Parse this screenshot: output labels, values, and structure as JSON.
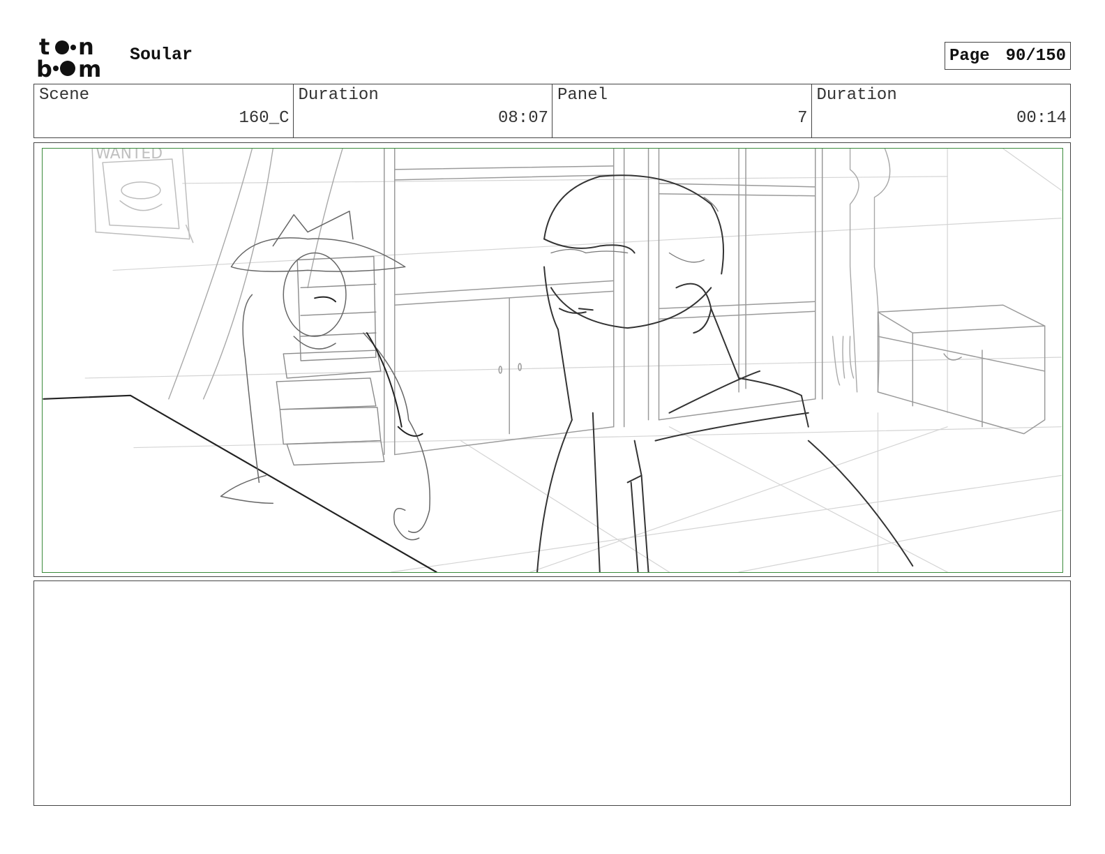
{
  "header": {
    "logo_text": "toon boom",
    "project_title": "Soular",
    "page_label": "Page",
    "page_number": "90/150"
  },
  "info": {
    "scene_label": "Scene",
    "scene_value": "160_C",
    "scene_duration_label": "Duration",
    "scene_duration_value": "08:07",
    "panel_label": "Panel",
    "panel_value": "7",
    "panel_duration_label": "Duration",
    "panel_duration_value": "00:14"
  },
  "panel": {
    "poster_text": "WANTED",
    "safe_frame_color": "#3a8a3a"
  },
  "notes": {
    "text": ""
  }
}
